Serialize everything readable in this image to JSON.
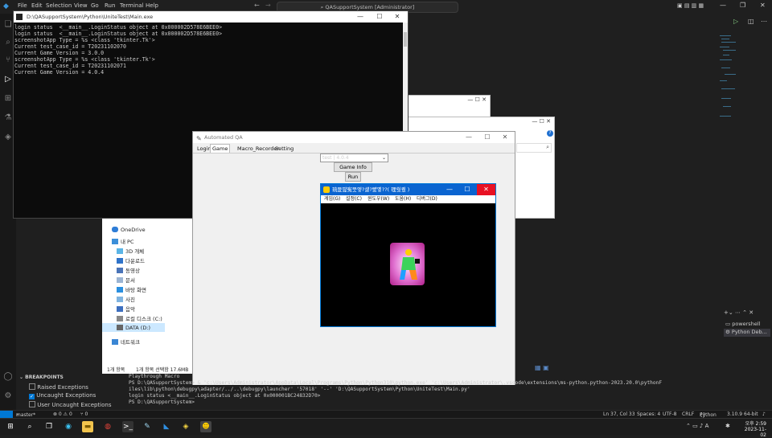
{
  "vscode": {
    "menu": [
      "File",
      "Edit",
      "Selection",
      "View",
      "Go",
      "Run",
      "Terminal",
      "Help"
    ],
    "search": "QASupportSystem [Administrator]",
    "status": {
      "branch": "master*",
      "problems": "⊗ 0 ⚠ 0",
      "ports": "⑂ 0",
      "position": "Ln 37, Col 33",
      "spaces": "Spaces: 4",
      "encoding": "UTF-8",
      "eol": "CRLF",
      "language": "Python",
      "interpreter": "3.10.9 64-bit"
    },
    "breakpoints": {
      "title": "BREAKPOINTS",
      "items": [
        {
          "label": "Raised Exceptions",
          "checked": false
        },
        {
          "label": "Uncaught Exceptions",
          "checked": true
        },
        {
          "label": "User Uncaught Exceptions",
          "checked": false
        }
      ]
    },
    "terminal_lines": [
      "Playthrough Macro",
      "PS D:\\QASupportSystem> & 'c:\\Users\\Administrator\\AppData\\Local\\Programs\\Python\\Python310\\python.exe' 'c:\\Users\\Administrator\\.vscode\\extensions\\ms-python.python-2023.20.0\\pythonF",
      "iles\\lib\\python\\debugpy\\adapter/../..\\debugpy\\launcher' '57018' '--' 'D:\\QASupportSystem\\Python\\UniteTest\\Main.py'",
      "login status  <__main__.LoginStatus object at 0x000001BC24832D70>",
      "PS D:\\QASupportSystem>"
    ],
    "terminal_list": [
      "powershell",
      "Python Deb..."
    ]
  },
  "console": {
    "title": "D:\\QASupportSystem\\Python\\UniteTest\\Main.exe",
    "lines": [
      "login status  <__main__.LoginStatus object at 0x000002D578E6BEE0>",
      "login status  <__main__.LoginStatus object at 0x000002D578E6BEE0>",
      "screenshotApp Type = %s <class 'tkinter.Tk'>",
      "Current test_case_id = T20231102070",
      "Current Game Version = 3.0.0",
      "screenshotApp Type = %s <class 'tkinter.Tk'>",
      "Current test_case_id = T20231102071",
      "Current Game Version = 4.0.4"
    ]
  },
  "explorer": {
    "items": [
      "OneDrive",
      "내 PC",
      "3D 개체",
      "다운로드",
      "동영상",
      "문서",
      "바탕 화면",
      "사진",
      "음악",
      "로컬 디스크 (C:)",
      "DATA (D:)",
      "네트워크"
    ],
    "status_count": "1개 항목",
    "status_selected": "1개 항목 선택함 17.6MB"
  },
  "qa": {
    "title": "Automated QA",
    "tabs": [
      "Login",
      "Game Info",
      "Macro_Recorder",
      "Setting"
    ],
    "active_tab": "Game Info",
    "version_select": "test | 4.0.4",
    "add_button": "Game Info Add",
    "run_button": "Run"
  },
  "game": {
    "title": "琉뚮땶寃뚯엫?섏?뺤옣??( 理쒓퀬 )",
    "menu": [
      "게임(G)",
      "설정(C)",
      "윈도우(W)",
      "도움(H)",
      "디버그(D)"
    ]
  },
  "clock": {
    "time": "오후 2:59",
    "date": "2023-11-02"
  }
}
